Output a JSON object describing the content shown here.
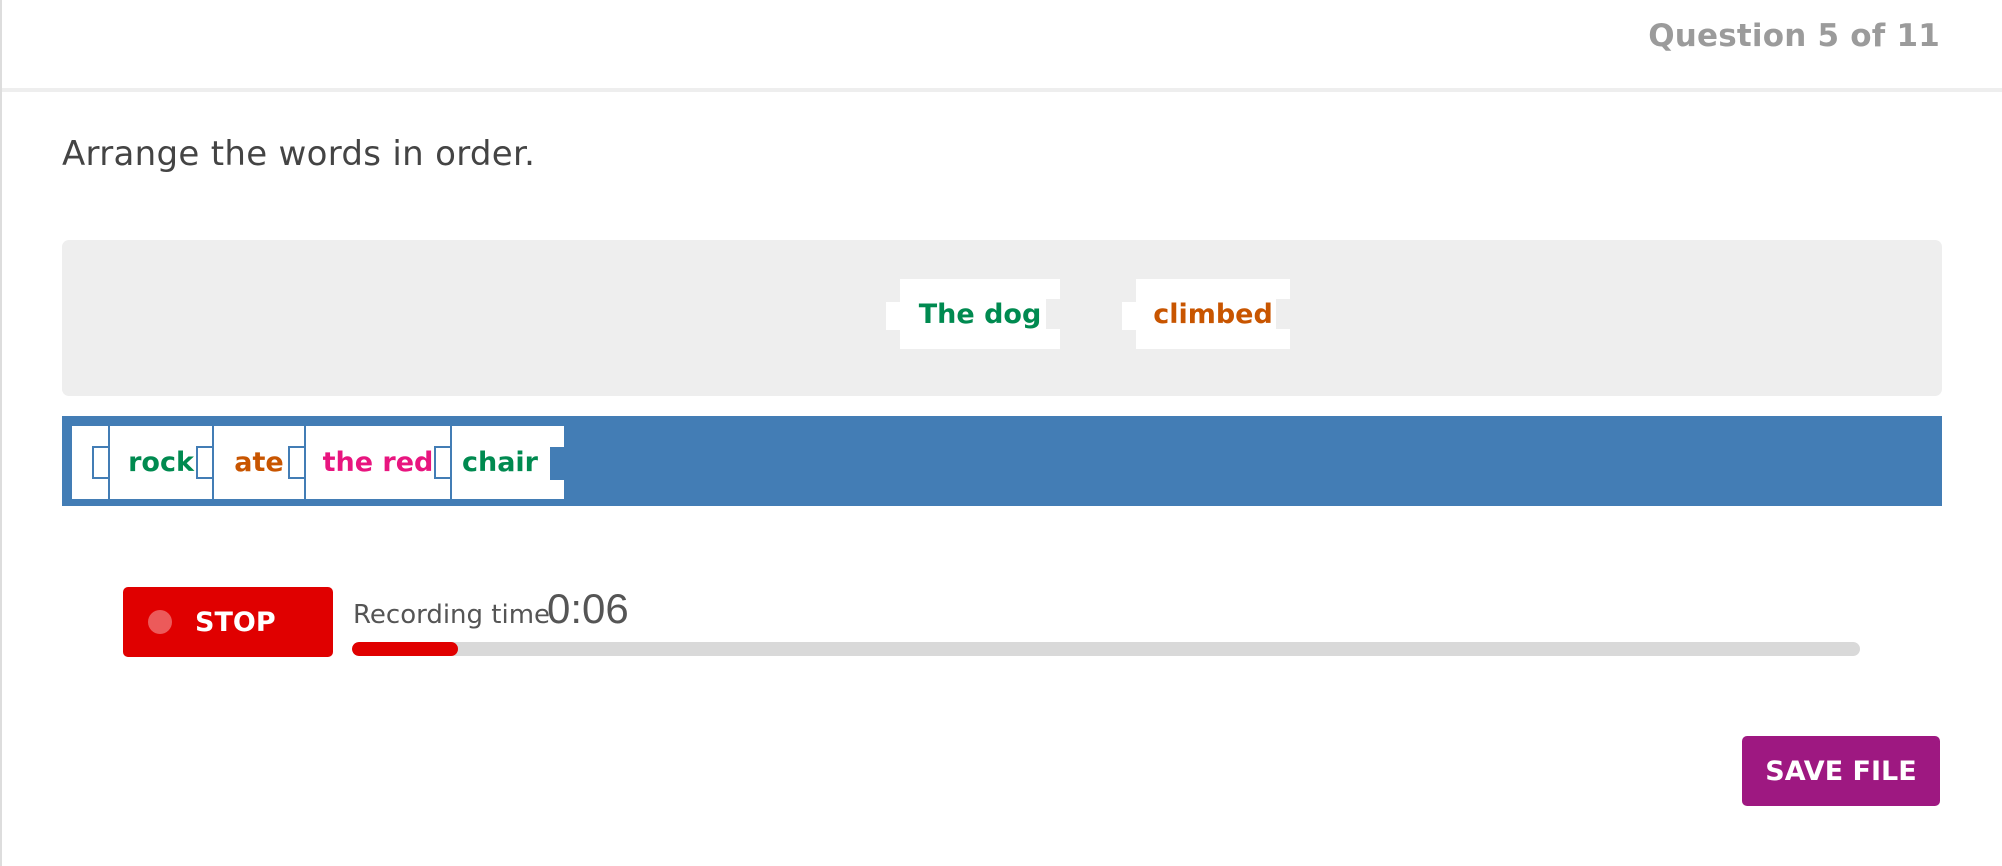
{
  "header": {
    "question_counter": "Question 5 of 11"
  },
  "prompt": "Arrange the words in order.",
  "answer_zone": {
    "placed_words": [
      {
        "text": "The dog",
        "color": "#008a50"
      },
      {
        "text": "climbed",
        "color": "#c85500"
      }
    ]
  },
  "word_bank": {
    "words": [
      {
        "text": "rock",
        "color": "#008a50"
      },
      {
        "text": "ate",
        "color": "#c85500"
      },
      {
        "text": "the red",
        "color": "#e8157f"
      },
      {
        "text": "chair",
        "color": "#008a50"
      }
    ]
  },
  "recorder": {
    "stop_label": "STOP",
    "time_label": "Recording time",
    "time_value": "0:06",
    "progress_percent": 7
  },
  "actions": {
    "save_label": "SAVE FILE"
  },
  "colors": {
    "bank_blue": "#437db5",
    "record_red": "#e00000",
    "save_purple": "#9e1881"
  }
}
